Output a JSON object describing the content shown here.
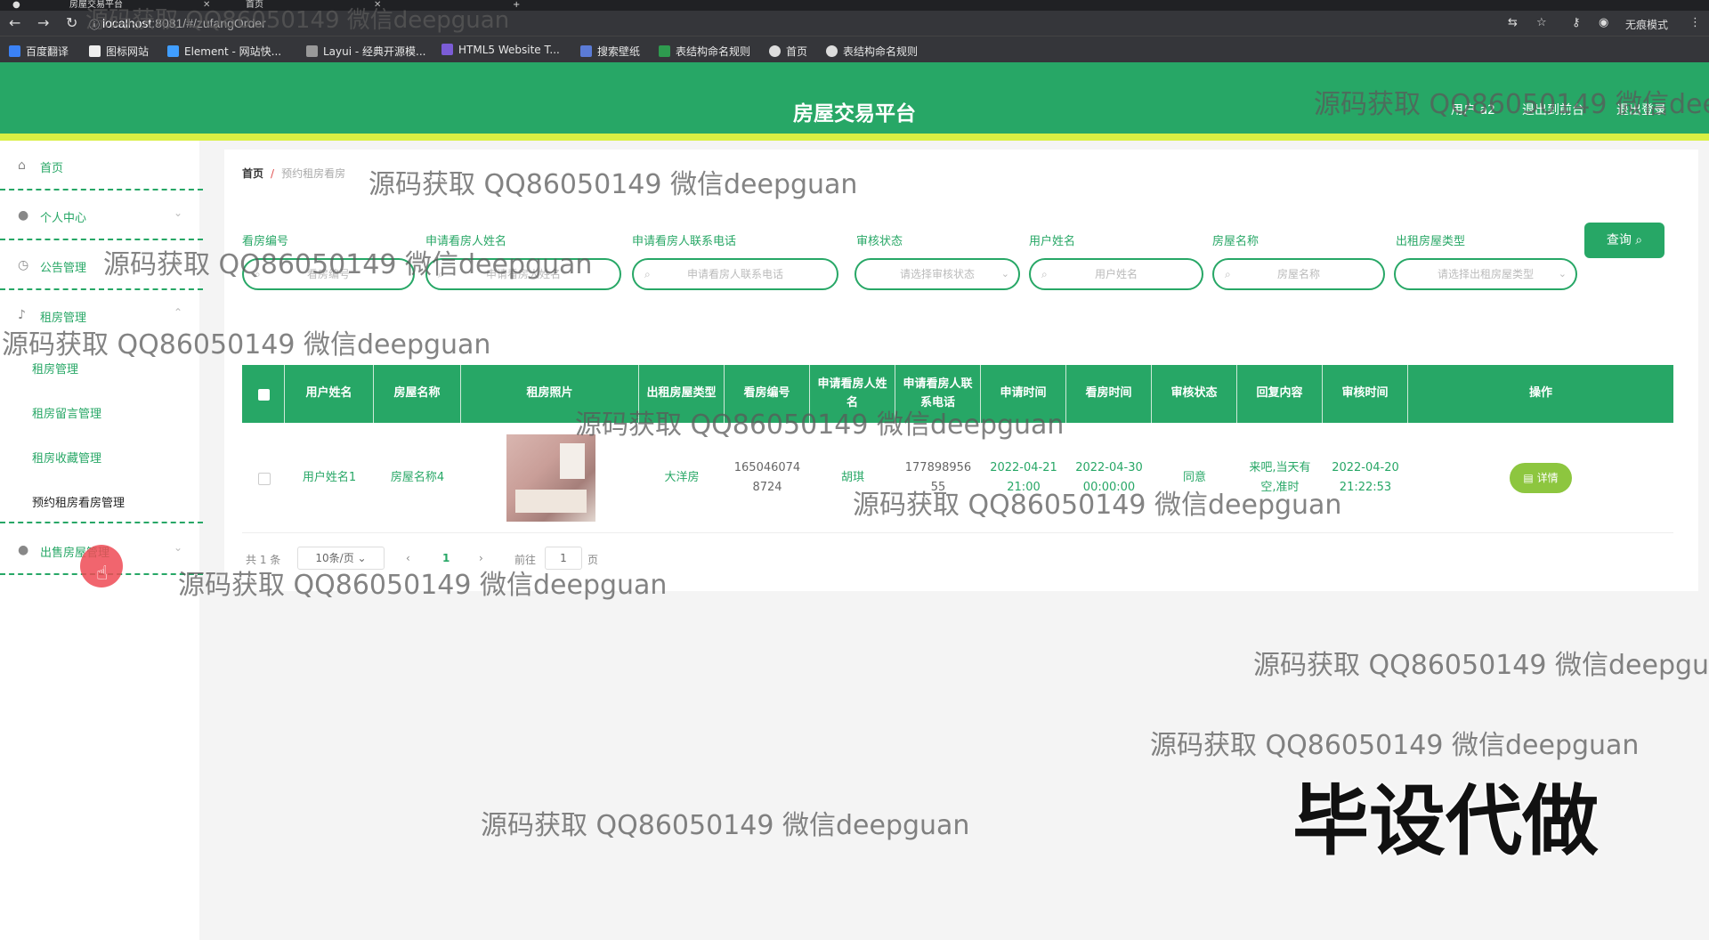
{
  "browser": {
    "tabs": [
      {
        "title": "房屋交易平台"
      },
      {
        "title": "首页"
      }
    ],
    "new_tab": "+",
    "url_host": "localhost",
    "url_rest": ":8081/#/zufangOrder",
    "profile_label": "无痕模式",
    "bookmarks": [
      "百度翻译",
      "图标网站",
      "Element - 网站快...",
      "Layui - 经典开源模...",
      "HTML5 Website T...",
      "搜索壁纸",
      "表结构命名规则",
      "首页",
      "表结构命名规则"
    ]
  },
  "header": {
    "title": "房屋交易平台",
    "user_label": "用户 a2",
    "back_front": "退出到前台",
    "logout": "退出登录"
  },
  "sidebar": {
    "items": [
      {
        "label": "首页",
        "icon": "home-icon"
      },
      {
        "label": "个人中心",
        "icon": "user-icon"
      },
      {
        "label": "公告管理",
        "icon": "clock-icon"
      },
      {
        "label": "租房管理",
        "icon": "mic-icon"
      },
      {
        "label": "出售房屋管理",
        "icon": "bulb-icon"
      }
    ],
    "sub_items": [
      "租房管理",
      "租房留言管理",
      "租房收藏管理",
      "预约租房看房管理"
    ]
  },
  "breadcrumb": {
    "home": "首页",
    "sep": "/",
    "current": "预约租房看房"
  },
  "filters": [
    {
      "label": "看房编号",
      "placeholder": "看房编号"
    },
    {
      "label": "申请看房人姓名",
      "placeholder": "申请看房人姓名"
    },
    {
      "label": "申请看房人联系电话",
      "placeholder": "申请看房人联系电话"
    },
    {
      "label": "审核状态",
      "placeholder": "请选择审核状态"
    },
    {
      "label": "用户姓名",
      "placeholder": "用户姓名"
    },
    {
      "label": "房屋名称",
      "placeholder": "房屋名称"
    },
    {
      "label": "出租房屋类型",
      "placeholder": "请选择出租房屋类型"
    }
  ],
  "query_button": "查询",
  "table": {
    "headers": [
      "用户姓名",
      "房屋名称",
      "租房照片",
      "出租房屋类型",
      "看房编号",
      "申请看房人姓名",
      "申请看房人联系电话",
      "申请时间",
      "看房时间",
      "审核状态",
      "回复内容",
      "审核时间",
      "操作"
    ],
    "rows": [
      {
        "user": "用户姓名1",
        "house": "房屋名称4",
        "type": "大洋房",
        "code": "1650460748724",
        "applicant": "胡琪",
        "phone": "17789895655",
        "apply_time": "2022-04-21 21:00",
        "view_time": "2022-04-30 00:00:00",
        "status": "同意",
        "reply": "来吧,当天有空,准时",
        "audit_time": "2022-04-20 21:22:53",
        "action": "详情"
      }
    ]
  },
  "pagination": {
    "total": "共 1 条",
    "page_size": "10条/页",
    "prev": "‹",
    "current": "1",
    "next": "›",
    "goto": "前往",
    "goto_value": "1",
    "page_suffix": "页"
  },
  "overlay": {
    "watermark": "源码获取 QQ86050149 微信deepguan",
    "stamp": "毕设代做"
  }
}
